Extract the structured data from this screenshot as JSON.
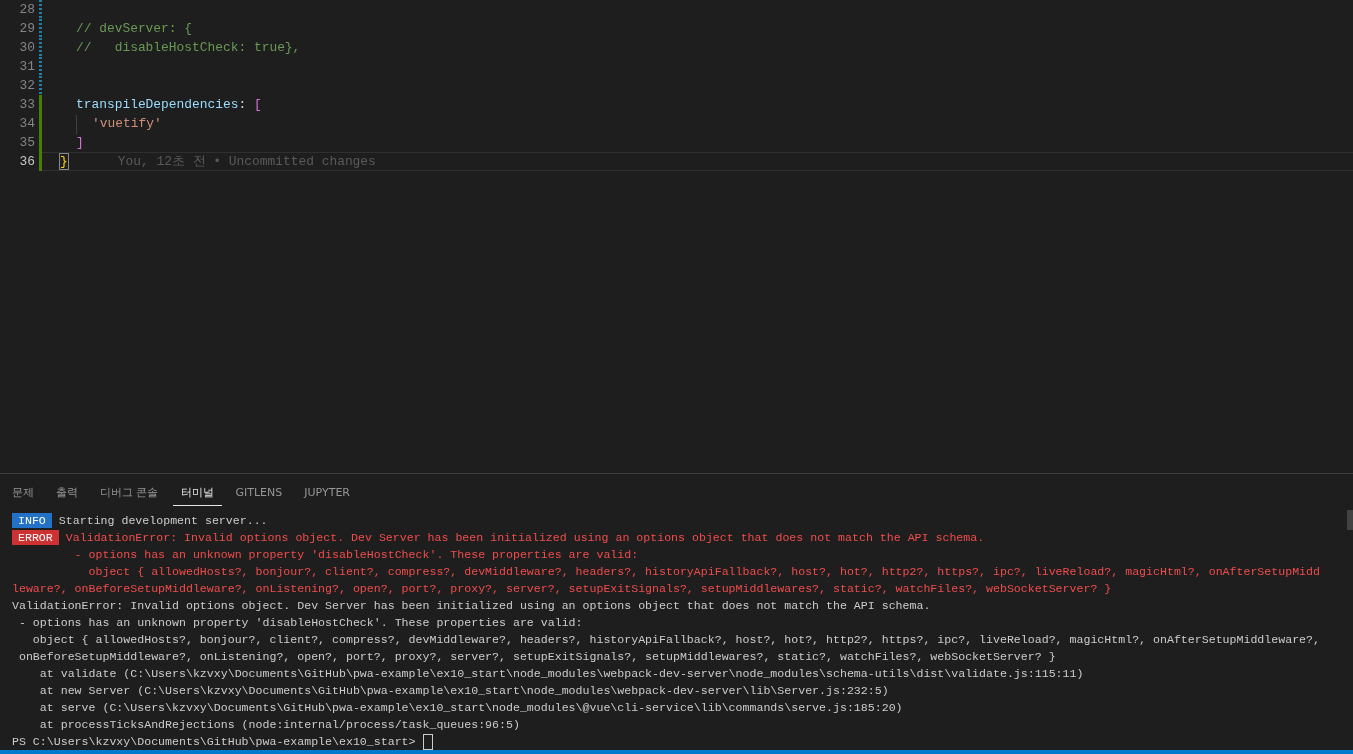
{
  "editor": {
    "lines": [
      {
        "number": "28",
        "kind": "modified"
      },
      {
        "number": "29",
        "kind": "modified",
        "tokens": [
          {
            "kind": "comment",
            "text": "// devServer: {"
          }
        ]
      },
      {
        "number": "30",
        "kind": "modified",
        "tokens": [
          {
            "kind": "comment",
            "text": "//   disableHostCheck: true},"
          }
        ]
      },
      {
        "number": "31",
        "kind": "modified"
      },
      {
        "number": "32",
        "kind": "modified"
      },
      {
        "number": "33",
        "kind": "added",
        "tokens": [
          {
            "kind": "key",
            "text": "transpileDependencies"
          },
          {
            "kind": "punct",
            "text": ":"
          },
          {
            "kind": "bracket",
            "text": "["
          }
        ]
      },
      {
        "number": "34",
        "kind": "added",
        "nested": true,
        "tokens": [
          {
            "kind": "string",
            "text": "'vuetify'"
          }
        ]
      },
      {
        "number": "35",
        "kind": "added",
        "tokens": [
          {
            "kind": "bracket",
            "text": "]"
          }
        ]
      },
      {
        "number": "36",
        "kind": "added",
        "current": true,
        "tokens": [
          {
            "kind": "matched",
            "text": "}"
          }
        ],
        "blame": "You, 12초 전 • Uncommitted changes"
      }
    ]
  },
  "panel": {
    "tabs": [
      {
        "label": "문제",
        "selected": false
      },
      {
        "label": "출력",
        "selected": false
      },
      {
        "label": "디버그 콘솔",
        "selected": false
      },
      {
        "label": "터미널",
        "selected": true
      },
      {
        "label": "GITLENS",
        "selected": false
      },
      {
        "label": "JUPYTER",
        "selected": false
      }
    ],
    "terminal": [
      {
        "kind": "info",
        "badge": "INFO",
        "text": "Starting development server..."
      },
      {
        "kind": "error",
        "badge": "ERROR",
        "text": "ValidationError: Invalid options object. Dev Server has been initialized using an options object that does not match the API schema."
      },
      {
        "kind": "error_text",
        "text": "         - options has an unknown property 'disableHostCheck'. These properties are valid:"
      },
      {
        "kind": "error_text",
        "text": "           object { allowedHosts?, bonjour?, client?, compress?, devMiddleware?, headers?, historyApiFallback?, host?, hot?, http2?, https?, ipc?, liveReload?, magicHtml?, onAfterSetupMidd"
      },
      {
        "kind": "error_text",
        "text": "leware?, onBeforeSetupMiddleware?, onListening?, open?, port?, proxy?, server?, setupExitSignals?, setupMiddlewares?, static?, watchFiles?, webSocketServer? }"
      },
      {
        "kind": "plain_text",
        "text": "ValidationError: Invalid options object. Dev Server has been initialized using an options object that does not match the API schema."
      },
      {
        "kind": "plain_text",
        "text": " - options has an unknown property 'disableHostCheck'. These properties are valid:"
      },
      {
        "kind": "plain_text",
        "text": "   object { allowedHosts?, bonjour?, client?, compress?, devMiddleware?, headers?, historyApiFallback?, host?, hot?, http2?, https?, ipc?, liveReload?, magicHtml?, onAfterSetupMiddleware?,"
      },
      {
        "kind": "plain_text",
        "text": " onBeforeSetupMiddleware?, onListening?, open?, port?, proxy?, server?, setupExitSignals?, setupMiddlewares?, static?, watchFiles?, webSocketServer? }"
      },
      {
        "kind": "plain_text",
        "text": "    at validate (C:\\Users\\kzvxy\\Documents\\GitHub\\pwa-example\\ex10_start\\node_modules\\webpack-dev-server\\node_modules\\schema-utils\\dist\\validate.js:115:11)"
      },
      {
        "kind": "plain_text",
        "text": "    at new Server (C:\\Users\\kzvxy\\Documents\\GitHub\\pwa-example\\ex10_start\\node_modules\\webpack-dev-server\\lib\\Server.js:232:5)"
      },
      {
        "kind": "plain_text",
        "text": "    at serve (C:\\Users\\kzvxy\\Documents\\GitHub\\pwa-example\\ex10_start\\node_modules\\@vue\\cli-service\\lib\\commands\\serve.js:185:20)"
      },
      {
        "kind": "plain_text",
        "text": "    at processTicksAndRejections (node:internal/process/task_queues:96:5)"
      },
      {
        "kind": "prompt",
        "text": "PS C:\\Users\\kzvxy\\Documents\\GitHub\\pwa-example\\ex10_start>"
      }
    ]
  }
}
